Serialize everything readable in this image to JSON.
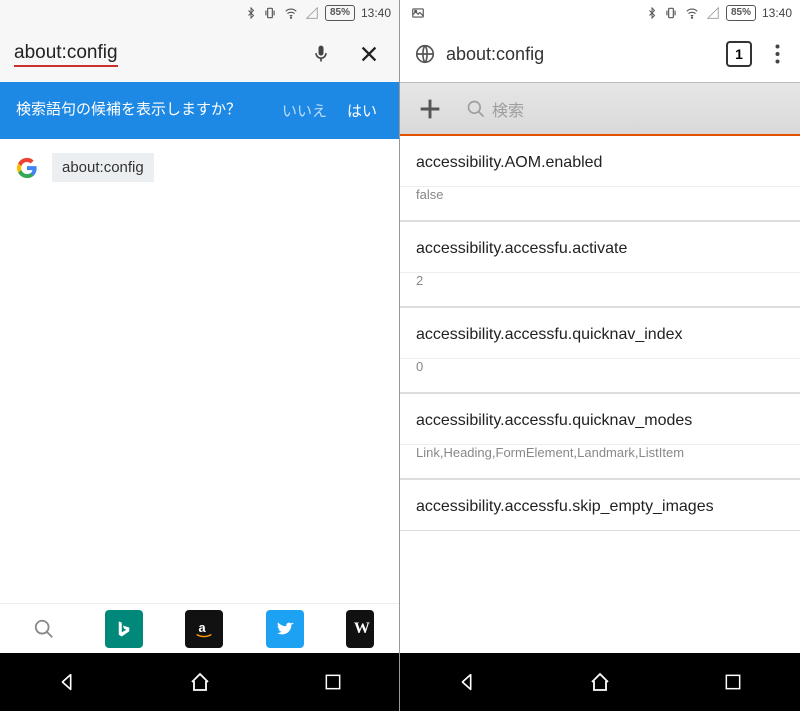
{
  "status": {
    "battery": "85%",
    "time": "13:40"
  },
  "left": {
    "search_text": "about:config",
    "banner": {
      "text": "検索語句の候補を表示しますか？",
      "no": "いいえ",
      "yes": "はい"
    },
    "suggestion_label": "about:config"
  },
  "right": {
    "address": "about:config",
    "tab_count": "1",
    "search_placeholder": "検索",
    "entries": [
      {
        "key": "accessibility.AOM.enabled",
        "value": "false"
      },
      {
        "key": "accessibility.accessfu.activate",
        "value": "2"
      },
      {
        "key": "accessibility.accessfu.quicknav_index",
        "value": "0"
      },
      {
        "key": "accessibility.accessfu.quicknav_modes",
        "value": "Link,Heading,FormElement,Landmark,ListItem"
      },
      {
        "key": "accessibility.accessfu.skip_empty_images",
        "value": ""
      }
    ]
  }
}
